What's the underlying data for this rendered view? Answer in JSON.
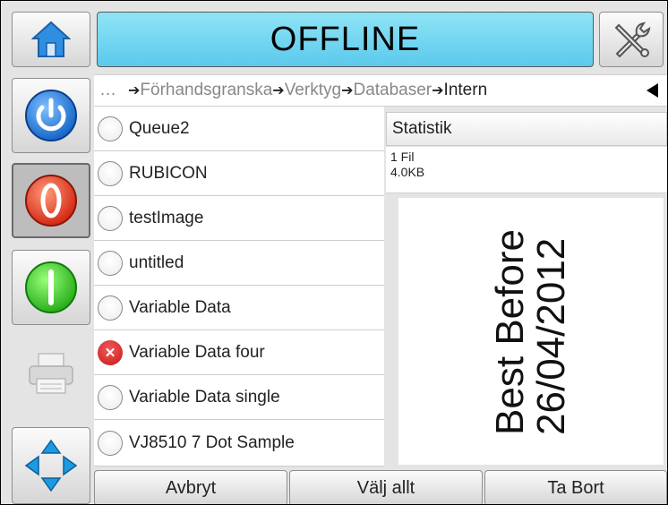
{
  "header": {
    "status": "OFFLINE",
    "home_icon": "home-icon",
    "tools_icon": "tools-icon"
  },
  "sidebar": {
    "icons": [
      "power-icon",
      "stop-icon",
      "start-icon",
      "printer-icon",
      "navigate-arrows-icon"
    ]
  },
  "breadcrumb": {
    "ellipsis": "…",
    "items": [
      "Förhandsgranska",
      "Verktyg",
      "Databaser",
      "Intern"
    ],
    "back_icon": "back-triangle-icon"
  },
  "file_list": [
    {
      "name": "Queue2",
      "state": "unselected"
    },
    {
      "name": "RUBICON",
      "state": "unselected"
    },
    {
      "name": "testImage",
      "state": "unselected"
    },
    {
      "name": "untitled",
      "state": "unselected"
    },
    {
      "name": "Variable Data",
      "state": "unselected"
    },
    {
      "name": "Variable Data four",
      "state": "error"
    },
    {
      "name": "Variable Data single",
      "state": "unselected"
    },
    {
      "name": "VJ8510 7 Dot Sample",
      "state": "unselected"
    }
  ],
  "statistics": {
    "title": "Statistik",
    "files": "1 Fil",
    "size": "4.0KB"
  },
  "preview": {
    "line1": "Best Before",
    "line2": "26/04/2012"
  },
  "footer": {
    "cancel_label": "Avbryt",
    "select_all_label": "Välj allt",
    "delete_label": "Ta Bort"
  },
  "colors": {
    "status_bg": "#6fd3f0",
    "power_blue": "#1d7fe0",
    "stop_red": "#e2321a",
    "start_green": "#2cc61e",
    "error_red": "#d42020"
  }
}
